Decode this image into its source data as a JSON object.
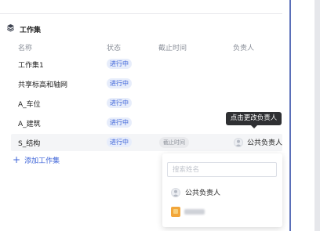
{
  "section": {
    "title": "工作集"
  },
  "table": {
    "headers": {
      "name": "名称",
      "status": "状态",
      "deadline": "截止时间",
      "owner": "负责人"
    },
    "rows": [
      {
        "name": "工作集1",
        "status": "进行中"
      },
      {
        "name": "共享标高和轴网",
        "status": "进行中"
      },
      {
        "name": "A_车位",
        "status": "进行中"
      },
      {
        "name": "A_建筑",
        "status": "进行中"
      },
      {
        "name": "S_结构",
        "status": "进行中",
        "deadline": "截止时间",
        "owner": "公共负责人"
      }
    ]
  },
  "add_link": {
    "label": "添加工作集"
  },
  "tooltip": {
    "text": "点击更改负责人"
  },
  "owner_dropdown": {
    "search_placeholder": "搜索姓名",
    "options": [
      {
        "label": "公共负责人",
        "icon": "user-icon"
      },
      {
        "label": "",
        "icon": "user-avatar"
      }
    ]
  },
  "colors": {
    "accent": "#3c63d8",
    "badge_bg": "#e7edfb",
    "tooltip_bg": "#2f3033",
    "panel_border": "#5a6fb8"
  }
}
